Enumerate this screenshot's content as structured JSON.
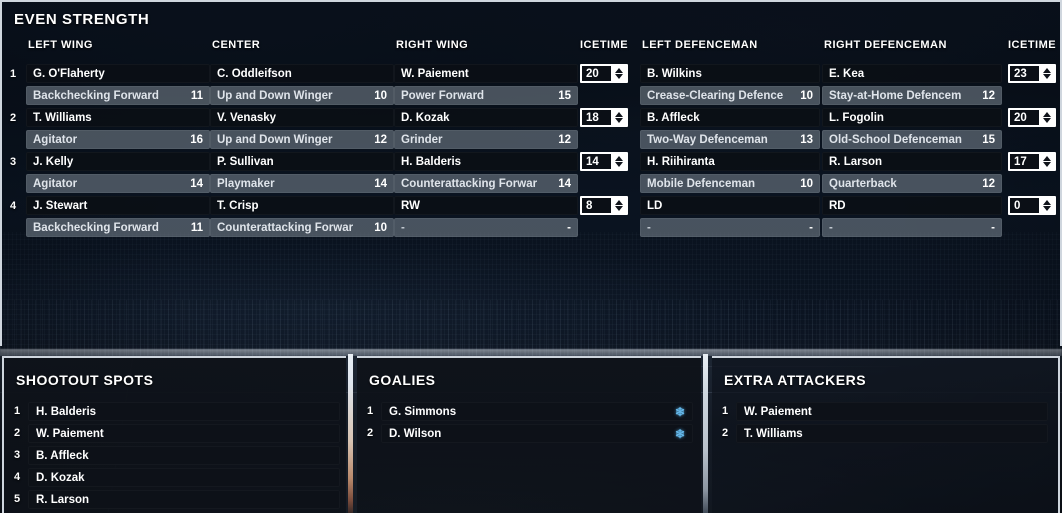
{
  "even_strength": {
    "title": "EVEN STRENGTH",
    "columns": [
      "LEFT WING",
      "CENTER",
      "RIGHT WING",
      "ICETIME",
      "LEFT DEFENCEMAN",
      "RIGHT DEFENCEMAN",
      "ICETIME"
    ],
    "lines": [
      {
        "index": "1",
        "lw": {
          "player": "G. O'Flaherty",
          "role": "Backchecking Forward",
          "rating": "11"
        },
        "c": {
          "player": "C. Oddleifson",
          "role": "Up and Down Winger",
          "rating": "10"
        },
        "rw": {
          "player": "W. Paiement",
          "role": "Power Forward",
          "rating": "15"
        },
        "f_icetime": "20",
        "ld": {
          "player": "B. Wilkins",
          "role": "Crease-Clearing Defence",
          "rating": "10"
        },
        "rd": {
          "player": "E. Kea",
          "role": "Stay-at-Home Defencem",
          "rating": "12"
        },
        "d_icetime": "23"
      },
      {
        "index": "2",
        "lw": {
          "player": "T. Williams",
          "role": "Agitator",
          "rating": "16"
        },
        "c": {
          "player": "V. Venasky",
          "role": "Up and Down Winger",
          "rating": "12"
        },
        "rw": {
          "player": "D. Kozak",
          "role": "Grinder",
          "rating": "12"
        },
        "f_icetime": "18",
        "ld": {
          "player": "B. Affleck",
          "role": "Two-Way Defenceman",
          "rating": "13"
        },
        "rd": {
          "player": "L. Fogolin",
          "role": "Old-School Defenceman",
          "rating": "15"
        },
        "d_icetime": "20"
      },
      {
        "index": "3",
        "lw": {
          "player": "J. Kelly",
          "role": "Agitator",
          "rating": "14"
        },
        "c": {
          "player": "P. Sullivan",
          "role": "Playmaker",
          "rating": "14"
        },
        "rw": {
          "player": "H. Balderis",
          "role": "Counterattacking Forwar",
          "rating": "14"
        },
        "f_icetime": "14",
        "ld": {
          "player": "H. Riihiranta",
          "role": "Mobile Defenceman",
          "rating": "10"
        },
        "rd": {
          "player": "R. Larson",
          "role": "Quarterback",
          "rating": "12"
        },
        "d_icetime": "17"
      },
      {
        "index": "4",
        "lw": {
          "player": "J. Stewart",
          "role": "Backchecking Forward",
          "rating": "11"
        },
        "c": {
          "player": "T. Crisp",
          "role": "Counterattacking Forwar",
          "rating": "10"
        },
        "rw": {
          "player": "RW",
          "role": "-",
          "rating": "-"
        },
        "f_icetime": "8",
        "ld": {
          "player": "LD",
          "role": "-",
          "rating": "-"
        },
        "rd": {
          "player": "RD",
          "role": "-",
          "rating": "-"
        },
        "d_icetime": "0"
      }
    ]
  },
  "shootout": {
    "title": "SHOOTOUT SPOTS",
    "rows": [
      {
        "index": "1",
        "player": "H. Balderis"
      },
      {
        "index": "2",
        "player": "W. Paiement"
      },
      {
        "index": "3",
        "player": "B. Affleck"
      },
      {
        "index": "4",
        "player": "D. Kozak"
      },
      {
        "index": "5",
        "player": "R. Larson"
      }
    ]
  },
  "goalies": {
    "title": "GOALIES",
    "icon": "snowflake-icon",
    "icon_glyph": "❄",
    "rows": [
      {
        "index": "1",
        "player": "G. Simmons",
        "status": "❄"
      },
      {
        "index": "2",
        "player": "D. Wilson",
        "status": "❄"
      }
    ]
  },
  "extra_attackers": {
    "title": "EXTRA ATTACKERS",
    "rows": [
      {
        "index": "1",
        "player": "W. Paiement"
      },
      {
        "index": "2",
        "player": "T. Williams"
      }
    ]
  },
  "colors": {
    "panel_border": "#cfd6de",
    "player_row_bg": "#0b0f16",
    "role_row_bg": "#707a86",
    "text_primary": "#ffffff",
    "text_role": "#dfe4ea",
    "snowflake": "#63b6e8"
  }
}
